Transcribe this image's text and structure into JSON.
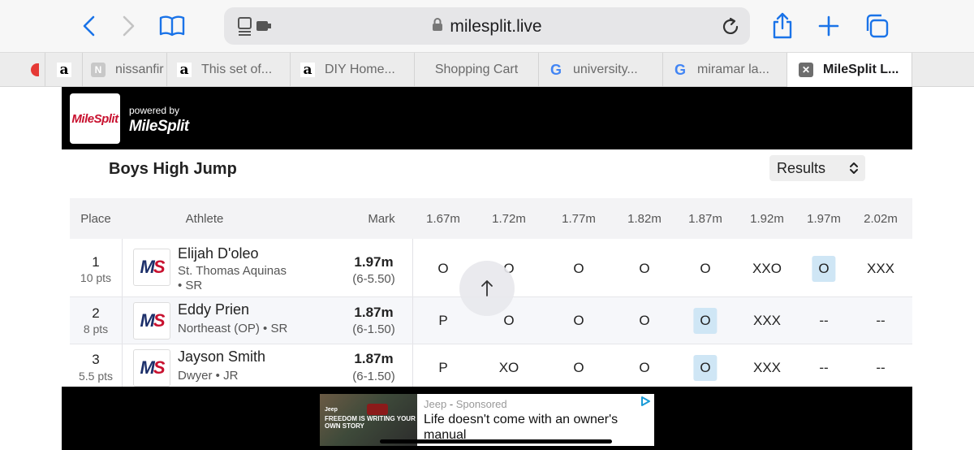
{
  "browser": {
    "url": "milesplit.live",
    "icons": {
      "back": "chevron-left-icon",
      "forward": "chevron-right-icon",
      "bookmarks": "book-icon",
      "tab_overview": "sidebar-icon",
      "reload": "reload-icon",
      "share": "share-icon",
      "new_tab": "plus-icon",
      "tabs": "tabs-icon"
    },
    "tabs": [
      {
        "label": "",
        "favicon": "amazon"
      },
      {
        "label": "nissanfir",
        "favicon": "N"
      },
      {
        "label": "This set of...",
        "favicon": "amazon"
      },
      {
        "label": "DIY Home...",
        "favicon": "amazon"
      },
      {
        "label": "Shopping Cart",
        "favicon": ""
      },
      {
        "label": "university...",
        "favicon": "google"
      },
      {
        "label": "miramar la...",
        "favicon": "google"
      },
      {
        "label": "MileSplit L...",
        "favicon": "close"
      }
    ]
  },
  "header": {
    "logo_text": "MileSplit",
    "powered_by": "powered by",
    "powered_brand": "MileSplit"
  },
  "event": {
    "title": "Boys High Jump",
    "view_select": "Results"
  },
  "table": {
    "headers": {
      "place": "Place",
      "athlete": "Athlete",
      "mark": "Mark",
      "heights": [
        "1.67m",
        "1.72m",
        "1.77m",
        "1.82m",
        "1.87m",
        "1.92m",
        "1.97m",
        "2.02m"
      ]
    },
    "rows": [
      {
        "place": "1",
        "points": "10 pts",
        "name": "Elijah D'oleo",
        "school": "St. Thomas Aquinas",
        "grade": "• SR",
        "mark": "1.97m",
        "mark_ft": "(6-5.50)",
        "attempts": [
          "O",
          "O",
          "O",
          "O",
          "O",
          "XXO",
          "O",
          "XXX"
        ],
        "highlight_index": 6
      },
      {
        "place": "2",
        "points": "8 pts",
        "name": "Eddy Prien",
        "school": "Northeast (OP) • SR",
        "grade": "",
        "mark": "1.87m",
        "mark_ft": "(6-1.50)",
        "attempts": [
          "P",
          "O",
          "O",
          "O",
          "O",
          "XXX",
          "--",
          "--"
        ],
        "highlight_index": 4
      },
      {
        "place": "3",
        "points": "5.5 pts",
        "name": "Jayson Smith",
        "school": "Dwyer • JR",
        "grade": "",
        "mark": "1.87m",
        "mark_ft": "(6-1.50)",
        "attempts": [
          "P",
          "XO",
          "O",
          "O",
          "O",
          "XXX",
          "--",
          "--"
        ],
        "highlight_index": 4
      }
    ]
  },
  "ad": {
    "brand": "Jeep",
    "sponsored": "Sponsored",
    "text": "Life doesn't come with an owner's manual",
    "image_text": "FREEDOM IS WRITING YOUR OWN STORY",
    "image_brand": "Jeep"
  },
  "colors": {
    "accent_blue": "#1a73e8",
    "highlight": "#cfe6f5",
    "brand_red": "#c8102e",
    "brand_navy": "#1c2f6a"
  }
}
